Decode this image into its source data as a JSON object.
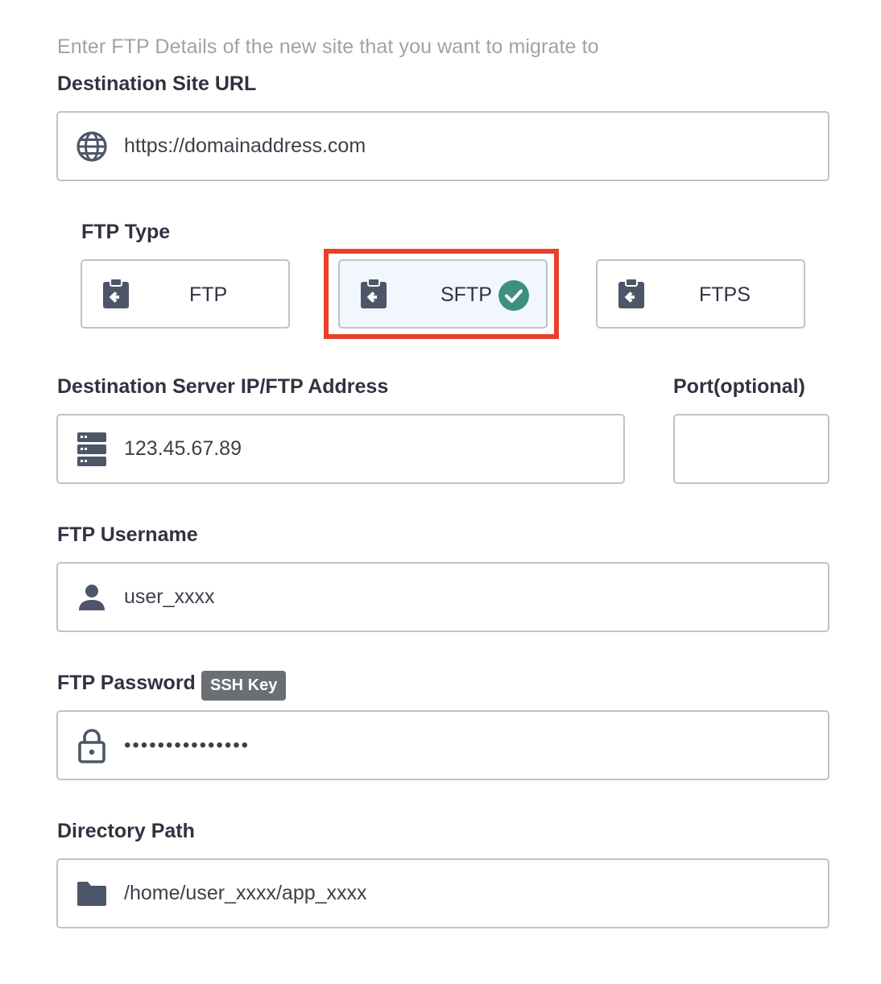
{
  "intro": "Enter FTP Details of the new site that you want to migrate to",
  "destination_url": {
    "label": "Destination Site URL",
    "value": "https://domainaddress.com",
    "icon": "globe-icon"
  },
  "ftp_type": {
    "label": "FTP Type",
    "options": [
      {
        "label": "FTP",
        "icon": "clipboard-arrow-icon",
        "selected": false
      },
      {
        "label": "SFTP",
        "icon": "clipboard-arrow-icon",
        "selected": true
      },
      {
        "label": "FTPS",
        "icon": "clipboard-arrow-icon",
        "selected": false
      }
    ]
  },
  "server": {
    "label": "Destination Server IP/FTP Address",
    "value": "123.45.67.89",
    "icon": "server-icon"
  },
  "port": {
    "label": "Port(optional)",
    "value": ""
  },
  "username": {
    "label": "FTP Username",
    "value": "user_xxxx",
    "icon": "user-icon"
  },
  "password": {
    "label": "FTP Password",
    "badge": "SSH Key",
    "value": "•••••••••••••••",
    "icon": "lock-icon"
  },
  "directory": {
    "label": "Directory Path",
    "value": "/home/user_xxxx/app_xxxx",
    "icon": "folder-icon"
  },
  "colors": {
    "icon": "#4d5669",
    "check": "#3f8f7e",
    "highlight": "#e8402a",
    "badge": "#6b6e73"
  }
}
